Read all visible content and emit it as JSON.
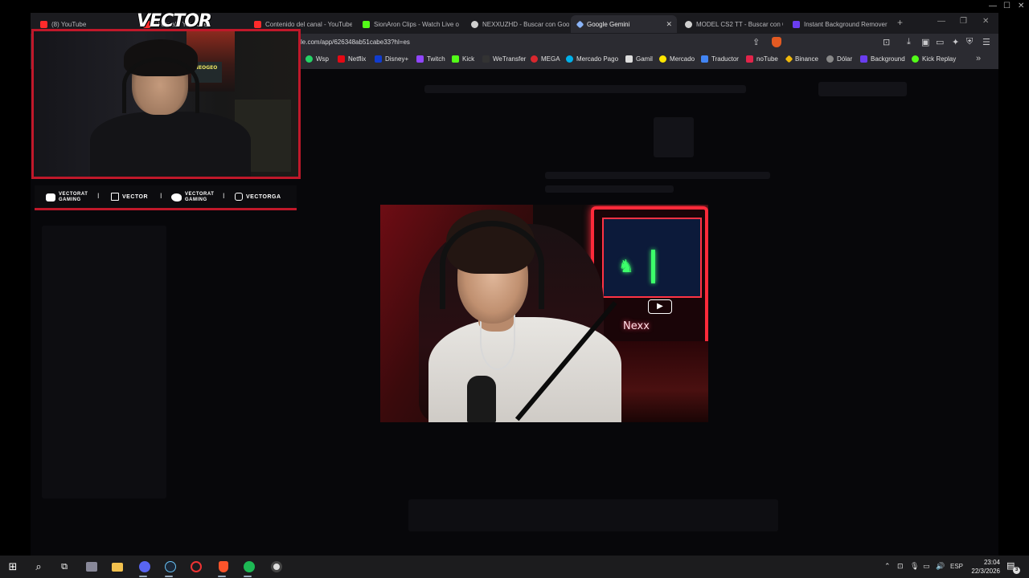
{
  "browser": {
    "tabs": [
      {
        "label": "(8) YouTube",
        "color": "#ff2b2b"
      },
      {
        "label": "el canal - YouTube",
        "color": "#ff2b2b"
      },
      {
        "label": "Contenido del canal - YouTube",
        "color": "#ff2b2b"
      },
      {
        "label": "SionAron Clips - Watch Live o",
        "color": "#53fc18"
      },
      {
        "label": "NEXXUZHD - Buscar con Goog",
        "color": "#cfcfcf"
      },
      {
        "label": "Google Gemini",
        "color": "#8ab4f8"
      },
      {
        "label": "MODEL CS2 TT - Buscar con G",
        "color": "#cfcfcf"
      },
      {
        "label": "Instant Background Remover",
        "color": "#6a3df0"
      }
    ],
    "close_glyph": "✕",
    "new_tab_glyph": "+",
    "url": "le.com/app/626348ab51cabe33?hl=es",
    "bookmarks": [
      {
        "label": "Wsp",
        "color": "#25d366"
      },
      {
        "label": "Netflix",
        "color": "#e50914"
      },
      {
        "label": "Disney+",
        "color": "#113ccf"
      },
      {
        "label": "Twitch",
        "color": "#9146ff"
      },
      {
        "label": "Kick",
        "color": "#53fc18"
      },
      {
        "label": "WeTransfer",
        "color": "#222222"
      },
      {
        "label": "MEGA",
        "color": "#d9272e"
      },
      {
        "label": "Mercado Pago",
        "color": "#00b1ea"
      },
      {
        "label": "Gamil",
        "color": "#dddddd"
      },
      {
        "label": "Mercado",
        "color": "#ffe600"
      },
      {
        "label": "Traductor",
        "color": "#4285f4"
      },
      {
        "label": "noTube",
        "color": "#e2244a"
      },
      {
        "label": "Binance",
        "color": "#f0b90b"
      },
      {
        "label": "Dólar",
        "color": "#888888"
      },
      {
        "label": "Background",
        "color": "#6a3df0"
      },
      {
        "label": "Kick Replay",
        "color": "#53fc18"
      }
    ],
    "more_glyph": "»"
  },
  "overlay": {
    "cam_title": "VECTOR",
    "arcade_label": "NEOGEO",
    "socials": [
      {
        "platform": "youtube",
        "line1": "VECTORAT",
        "line2": "GAMING"
      },
      {
        "platform": "twitch",
        "line1": "VECTOR",
        "line2": ""
      },
      {
        "platform": "twitter",
        "line1": "VECTORAT",
        "line2": "GAMING"
      },
      {
        "platform": "instagram",
        "line1": "VECTORGA",
        "line2": ""
      }
    ],
    "separator": "I",
    "accent_color": "#c0182a"
  },
  "video": {
    "neon_text": "Nexx",
    "play_glyph": "▶"
  },
  "taskbar": {
    "language": "ESP",
    "time": "23:04",
    "date": "22/3/2026",
    "notification_count": "3"
  }
}
